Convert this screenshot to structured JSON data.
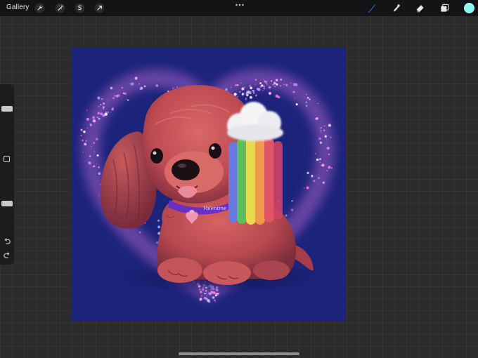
{
  "toolbar": {
    "gallery_label": "Gallery",
    "left_icons": [
      "wrench-icon",
      "magic-wand-icon",
      "selection-icon",
      "transform-arrow-icon"
    ],
    "right_icons": [
      "brush-icon",
      "smudge-icon",
      "eraser-icon",
      "layers-icon"
    ],
    "active_tool": "brush",
    "active_tool_color": "#3d7bff",
    "current_color": "#8ff5ef"
  },
  "sidebar": {
    "brush_size_level": 0.7,
    "opacity_level": 0.4,
    "icons": [
      "modify-square-icon",
      "undo-icon",
      "redo-icon"
    ]
  },
  "canvas": {
    "background_color": "#1c237a",
    "artwork": "red cocker spaniel puppy with rainbow cloud hair clip inside sparkly pink heart"
  }
}
